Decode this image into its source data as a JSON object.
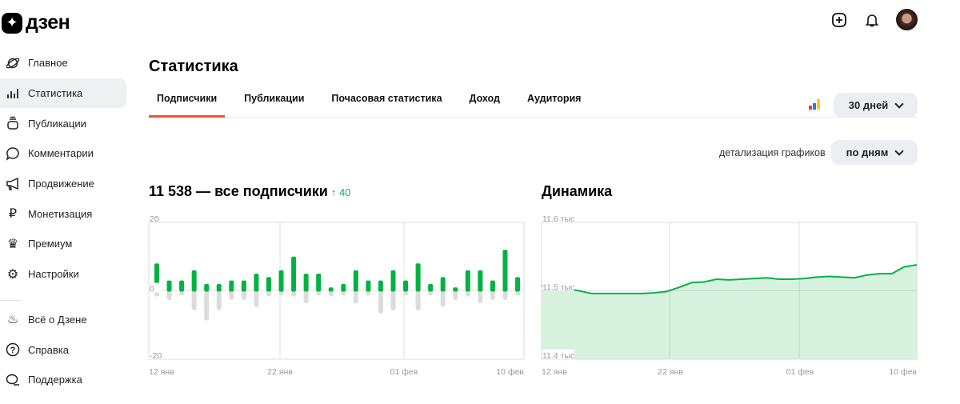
{
  "logo": {
    "text": "дзен"
  },
  "sidebar": {
    "items": [
      {
        "label": "Главное",
        "icon": "planet-icon"
      },
      {
        "label": "Статистика",
        "icon": "stats-icon",
        "active": true
      },
      {
        "label": "Публикации",
        "icon": "publications-icon"
      },
      {
        "label": "Комментарии",
        "icon": "comment-icon"
      },
      {
        "label": "Продвижение",
        "icon": "megaphone-icon"
      },
      {
        "label": "Монетизация",
        "icon": "ruble-icon"
      },
      {
        "label": "Премиум",
        "icon": "crown-icon"
      },
      {
        "label": "Настройки",
        "icon": "gear-icon"
      }
    ],
    "items2": [
      {
        "label": "Всё о Дзене",
        "icon": "flame-icon"
      },
      {
        "label": "Справка",
        "icon": "help-icon"
      },
      {
        "label": "Поддержка",
        "icon": "support-icon"
      }
    ]
  },
  "header": {
    "title": "Статистика"
  },
  "tabs": [
    "Подписчики",
    "Публикации",
    "Почасовая статистика",
    "Доход",
    "Аудитория"
  ],
  "period": "30 дней",
  "detail": {
    "label": "детализация графиков",
    "value": "по дням"
  },
  "subscribers": {
    "title": "11 538 — все подписчики",
    "delta": "↑ 40"
  },
  "dynamics": {
    "title": "Динамика"
  },
  "colors": {
    "accent": "#f2542d",
    "green": "#00b341",
    "fill": "#d8f2e0",
    "neg": "#dcdcdc"
  },
  "chart_data": [
    {
      "type": "bar",
      "title": "11 538 — все подписчики",
      "xticks": [
        "12 янв",
        "22 янв",
        "01 фев",
        "10 фев"
      ],
      "yticks": [
        "20",
        "0",
        "-20"
      ],
      "ylim": [
        -20,
        20
      ],
      "series": [
        {
          "name": "subscribed",
          "values": [
            8,
            3,
            3,
            6,
            2,
            2,
            3,
            3,
            5,
            4,
            6,
            10,
            5,
            5,
            1,
            2,
            6,
            3,
            3,
            6,
            3,
            8,
            2,
            4,
            1,
            6,
            6,
            3,
            12,
            4
          ]
        },
        {
          "name": "unsubscribed",
          "values": [
            -1,
            -2,
            0,
            -5,
            -8,
            -5,
            -2,
            -2,
            -4,
            -1,
            0,
            -1,
            -3,
            0,
            -1,
            0,
            -3,
            0,
            -6,
            -5,
            0,
            -5,
            0,
            -4,
            -2,
            -1,
            -3,
            -2,
            -2,
            0
          ]
        }
      ]
    },
    {
      "type": "area",
      "title": "Динамика",
      "xticks": [
        "12 янв",
        "22 янв",
        "01 фев",
        "10 фев"
      ],
      "yticks": [
        "11.6 тыс",
        "11.5 тыс",
        "11.4 тыс"
      ],
      "ylim": [
        11400,
        11600
      ],
      "values": [
        11507,
        11507,
        11503,
        11500,
        11496,
        11496,
        11496,
        11496,
        11496,
        11497,
        11499,
        11505,
        11512,
        11513,
        11517,
        11516,
        11517,
        11518,
        11519,
        11517,
        11517,
        11518,
        11520,
        11521,
        11520,
        11519,
        11523,
        11525,
        11525,
        11535,
        11538
      ]
    }
  ]
}
